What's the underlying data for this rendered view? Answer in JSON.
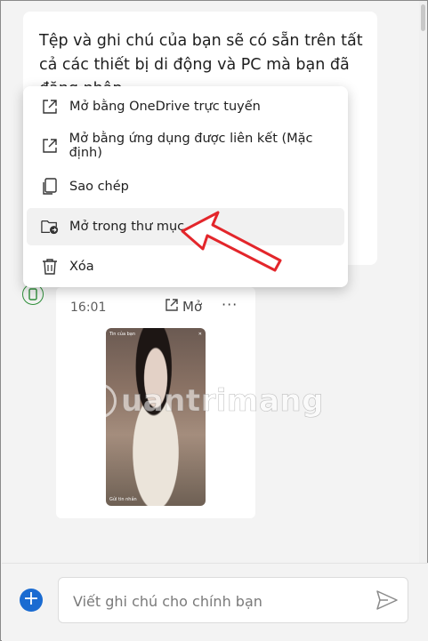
{
  "message": {
    "text": "Tệp và ghi chú của bạn sẽ có sẵn trên tất cả các thiết bị di động và PC mà bạn đã đăng nhập."
  },
  "context_menu": {
    "items": [
      {
        "label": "Mở bằng OneDrive trực tuyến",
        "icon": "open-external-icon"
      },
      {
        "label": "Mở bằng ứng dụng được liên kết (Mặc định)",
        "icon": "open-external-icon"
      },
      {
        "label": "Sao chép",
        "icon": "copy-icon"
      },
      {
        "label": "Mở trong thư mục",
        "icon": "folder-open-icon"
      },
      {
        "label": "Xóa",
        "icon": "trash-icon"
      }
    ],
    "highlighted_index": 3
  },
  "file_message": {
    "time": "16:01",
    "open_label": "Mở",
    "more_label": "···",
    "thumbnail": {
      "top_left": "Tin của bạn",
      "top_close": "✕",
      "bottom_left": "Gửi tin nhắn"
    }
  },
  "watermark": "uantrimang",
  "composer": {
    "add_label": "+",
    "placeholder": "Viết ghi chú cho chính bạn"
  },
  "colors": {
    "accent": "#1a6bd1",
    "arrow": "#e3262b",
    "device_badge": "#2f8f3a"
  }
}
